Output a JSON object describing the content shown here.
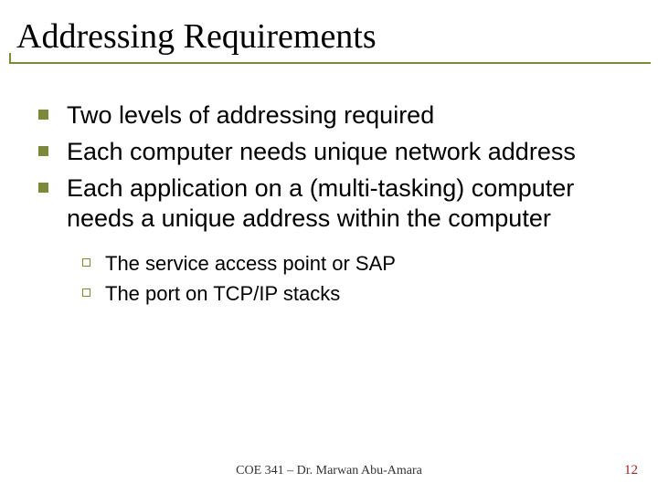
{
  "title": "Addressing Requirements",
  "bullets": [
    "Two levels of addressing required",
    "Each computer needs unique network address",
    "Each application on a (multi-tasking) computer needs a unique address within the computer"
  ],
  "subbullets": [
    "The service access point or SAP",
    "The port on TCP/IP stacks"
  ],
  "footer": {
    "center": "COE 341 – Dr. Marwan Abu-Amara",
    "page": "12"
  }
}
